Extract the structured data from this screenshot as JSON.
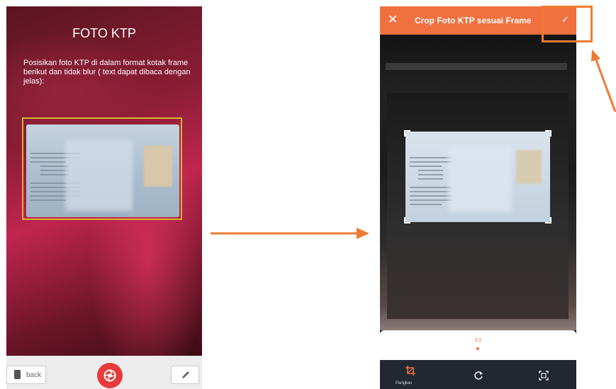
{
  "camera_screen": {
    "title": "FOTO KTP",
    "instructions": "Posisikan foto KTP di dalam format kotak frame berikut dan tidak blur ( text dapat dibaca dengan jelas):",
    "back_label": "back"
  },
  "crop_screen": {
    "title": "Crop Foto KTP sesuai Frame",
    "close_glyph": "✕",
    "confirm_glyph": "✓",
    "ratio_label": "3:2",
    "tools": [
      {
        "label": "Pangkas",
        "icon": "crop-icon"
      },
      {
        "label": "",
        "icon": "rotate-icon"
      },
      {
        "label": "",
        "icon": "fit-frame-icon"
      }
    ]
  },
  "colors": {
    "accent": "#f07040",
    "shutter": "#e83a3a",
    "frame": "#d9b430"
  }
}
